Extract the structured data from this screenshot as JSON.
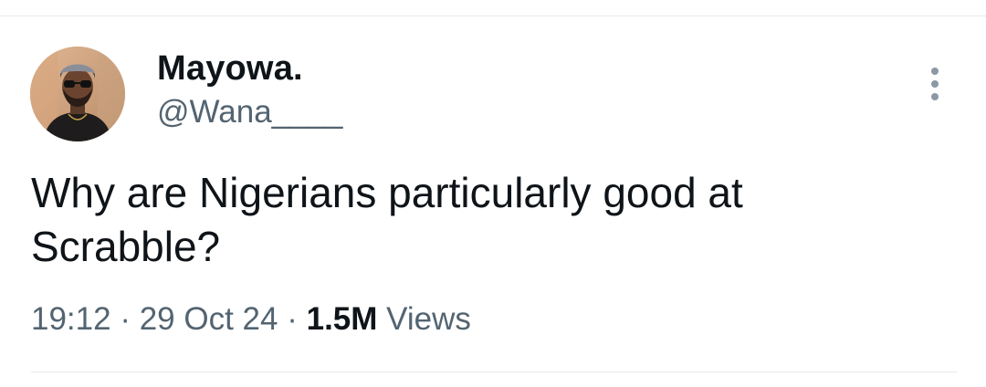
{
  "author": {
    "display_name": "Mayowa.",
    "handle": "@Wana____",
    "avatar_icon": "profile-photo"
  },
  "tweet": {
    "text": "Why are Nigerians particularly good at\nScrabble?"
  },
  "meta": {
    "time": "19:12",
    "separator": "·",
    "date": "29 Oct 24",
    "views_count": "1.5M",
    "views_label": "Views"
  },
  "actions": {
    "more_icon": "more-vertical-icon"
  },
  "colors": {
    "text_primary": "#0f1419",
    "text_secondary": "#536471",
    "divider": "#e6e9ec",
    "background": "#ffffff"
  }
}
